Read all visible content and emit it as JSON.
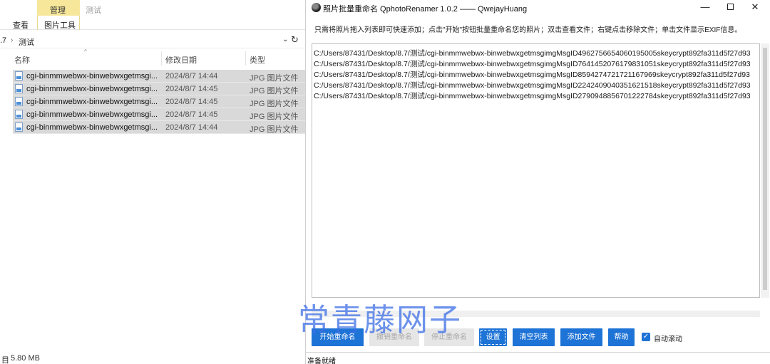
{
  "explorer": {
    "ribbon": {
      "tab_view": "查看",
      "context_group": "管理",
      "tab_picture_tools": "图片工具",
      "window_title": "测试"
    },
    "address": {
      "crumb_parent": ".7",
      "crumb_current": "测试"
    },
    "columns": {
      "name": "名称",
      "date": "修改日期",
      "type": "类型"
    },
    "files": [
      {
        "name": "cgi-binmmwebwx-binwebwxgetmsgi...",
        "date": "2024/8/7 14:44",
        "type": "JPG 图片文件"
      },
      {
        "name": "cgi-binmmwebwx-binwebwxgetmsgi...",
        "date": "2024/8/7 14:45",
        "type": "JPG 图片文件"
      },
      {
        "name": "cgi-binmmwebwx-binwebwxgetmsgi...",
        "date": "2024/8/7 14:45",
        "type": "JPG 图片文件"
      },
      {
        "name": "cgi-binmmwebwx-binwebwxgetmsgi...",
        "date": "2024/8/7 14:45",
        "type": "JPG 图片文件"
      },
      {
        "name": "cgi-binmmwebwx-binwebwxgetmsgi...",
        "date": "2024/8/7 14:44",
        "type": "JPG 图片文件"
      }
    ],
    "status": {
      "count": "目",
      "size": "5.80 MB"
    }
  },
  "renamer": {
    "title": "照片批量重命名 QphotoRenamer 1.0.2 —— QwejayHuang",
    "hint": "只需将照片拖入列表即可快速添加；点击\"开始\"按钮批量重命名您的照片；双击查看文件；右键点击移除文件；单击文件显示EXIF信息。",
    "paths": [
      "C:/Users/87431/Desktop/8.7/测试/cgi-binmmwebwx-binwebwxgetmsgimgMsgID4962756654060195005skeycrypt892fa311d5f27d93",
      "C:/Users/87431/Desktop/8.7/测试/cgi-binmmwebwx-binwebwxgetmsgimgMsgID7641452076179831051skeycrypt892fa311d5f27d93",
      "C:/Users/87431/Desktop/8.7/测试/cgi-binmmwebwx-binwebwxgetmsgimgMsgID8594274721721167969skeycrypt892fa311d5f27d93",
      "C:/Users/87431/Desktop/8.7/测试/cgi-binmmwebwx-binwebwxgetmsgimgMsgID2242409040351621518skeycrypt892fa311d5f27d93",
      "C:/Users/87431/Desktop/8.7/测试/cgi-binmmwebwx-binwebwxgetmsgimgMsgID2790948856701222784skeycrypt892fa311d5f27d93"
    ],
    "buttons": {
      "start": "开始重命名",
      "undo": "撤销重命名",
      "stop": "停止重命名",
      "settings": "设置",
      "clear": "清空列表",
      "add": "添加文件",
      "help": "帮助"
    },
    "autoscroll_label": "自动滚动",
    "autoscroll_checked": true,
    "status": "准备就绪",
    "colors": {
      "accent": "#1e73d6",
      "disabled": "#e6e6e6"
    }
  },
  "watermark": "常青藤网子"
}
